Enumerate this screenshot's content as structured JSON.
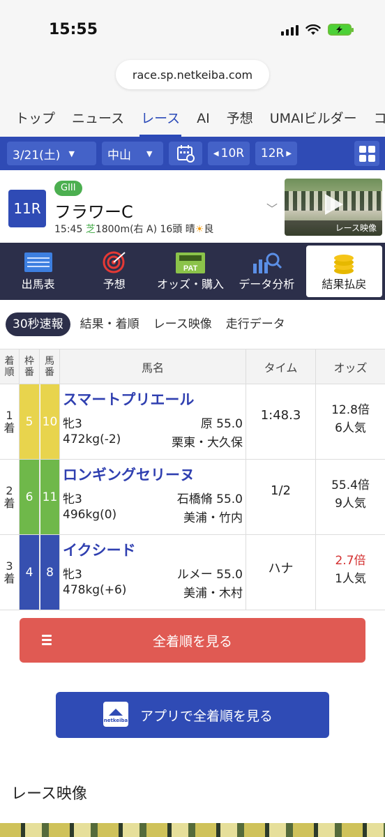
{
  "status_bar": {
    "time": "15:55"
  },
  "browser": {
    "url": "race.sp.netkeiba.com"
  },
  "nav_tabs": [
    {
      "label": "トップ"
    },
    {
      "label": "ニュース"
    },
    {
      "label": "レース",
      "active": true
    },
    {
      "label": "AI"
    },
    {
      "label": "予想"
    },
    {
      "label": "UMAIビルダー"
    },
    {
      "label": "コラ"
    }
  ],
  "date_bar": {
    "date": "3/21(土)",
    "venue": "中山",
    "prev_race": "10R",
    "next_race": "12R"
  },
  "race": {
    "number": "11R",
    "grade": "GIII",
    "name": "フラワーC",
    "time": "15:45",
    "surface": "芝",
    "distance": "1800m(右 A)",
    "runners": "16頭",
    "weather": "晴",
    "condition": "良",
    "video_caption": "レース映像"
  },
  "menu": [
    {
      "label": "出馬表",
      "icon": "entry-list-icon"
    },
    {
      "label": "予想",
      "icon": "target-icon"
    },
    {
      "label": "オッズ・購入",
      "icon": "ipat-icon"
    },
    {
      "label": "データ分析",
      "icon": "chart-search-icon"
    },
    {
      "label": "結果払戻",
      "icon": "coins-icon",
      "active": true
    }
  ],
  "sub_tabs": [
    {
      "label": "30秒速報",
      "active": true
    },
    {
      "label": "結果・着順"
    },
    {
      "label": "レース映像"
    },
    {
      "label": "走行データ"
    }
  ],
  "table": {
    "headers": {
      "rank": [
        "着",
        "順"
      ],
      "waku": [
        "枠",
        "番"
      ],
      "umaban": [
        "馬",
        "番"
      ],
      "name": "馬名",
      "time": "タイム",
      "odds": "オッズ"
    },
    "rows": [
      {
        "rank": [
          "1",
          "着"
        ],
        "waku": "5",
        "waku_color": "#e8d44d",
        "umaban": "10",
        "name": "スマートプリエール",
        "sex_age": "牝3",
        "jockey": "原 55.0",
        "weight": "472kg(-2)",
        "trainer": "栗東・大久保",
        "time": "1:48.3",
        "odds": "12.8倍",
        "popularity": "6人気",
        "favorite": false
      },
      {
        "rank": [
          "2",
          "着"
        ],
        "waku": "6",
        "waku_color": "#6fb84a",
        "umaban": "11",
        "name": "ロンギングセリーヌ",
        "sex_age": "牝3",
        "jockey": "石橋脩 55.0",
        "weight": "496kg(0)",
        "trainer": "美浦・竹内",
        "time": "1/2",
        "odds": "55.4倍",
        "popularity": "9人気",
        "favorite": false
      },
      {
        "rank": [
          "3",
          "着"
        ],
        "waku": "4",
        "waku_color": "#3650b0",
        "umaban": "8",
        "name": "イクシード",
        "sex_age": "牝3",
        "jockey": "ルメー 55.0",
        "weight": "478kg(+6)",
        "trainer": "美浦・木村",
        "time": "ハナ",
        "odds": "2.7倍",
        "popularity": "1人気",
        "favorite": true
      }
    ]
  },
  "buttons": {
    "all_results": "全着順を見る",
    "app_results": "アプリで全着順を見る",
    "app_logo_text": "netkeiba"
  },
  "section_title": "レース映像"
}
